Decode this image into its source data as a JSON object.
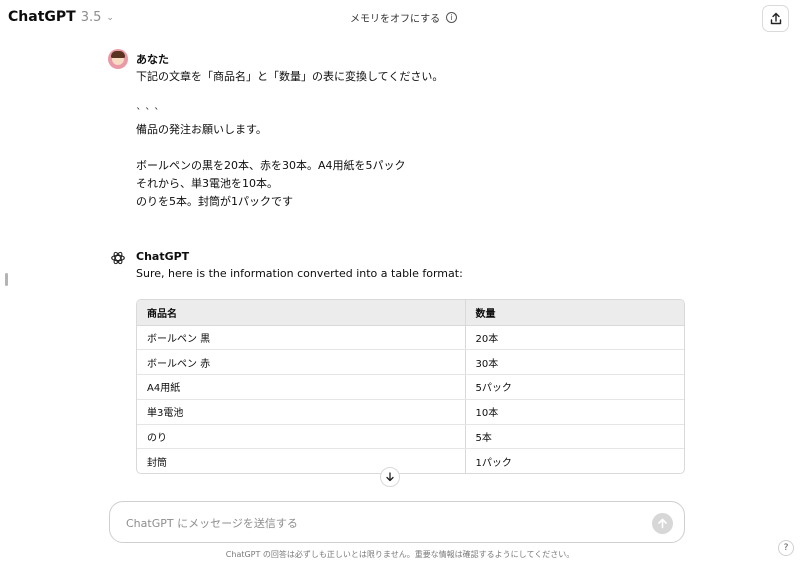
{
  "header": {
    "model_name": "ChatGPT",
    "model_version": "3.5",
    "memory_label": "メモリをオフにする"
  },
  "conversation": {
    "user": {
      "sender": "あなた",
      "text": "下記の文章を「商品名」と「数量」の表に変換してください。\n\n` ` `\n備品の発注お願いします。\n\nボールペンの黒を20本、赤を30本。A4用紙を5パック\nそれから、単3電池を10本。\nのりを5本。封筒が1パックです"
    },
    "assistant": {
      "sender": "ChatGPT",
      "intro": "Sure, here is the information converted into a table format:",
      "table": {
        "headers": [
          "商品名",
          "数量"
        ],
        "rows": [
          [
            "ボールペン 黒",
            "20本"
          ],
          [
            "ボールペン 赤",
            "30本"
          ],
          [
            "A4用紙",
            "5パック"
          ],
          [
            "単3電池",
            "10本"
          ],
          [
            "のり",
            "5本"
          ],
          [
            "封筒",
            "1パック"
          ]
        ]
      }
    }
  },
  "composer": {
    "placeholder": "ChatGPT にメッセージを送信する",
    "value": ""
  },
  "footer": {
    "disclaimer": "ChatGPT の回答は必ずしも正しいとは限りません。重要な情報は確認するようにしてください。",
    "help_label": "?"
  },
  "icons": {
    "model_chevron": "chevron-down-icon",
    "memory_info": "info-icon",
    "share": "share-icon",
    "assistant_avatar": "openai-logo-icon",
    "scroll_down": "arrow-down-icon",
    "send": "arrow-up-icon"
  }
}
